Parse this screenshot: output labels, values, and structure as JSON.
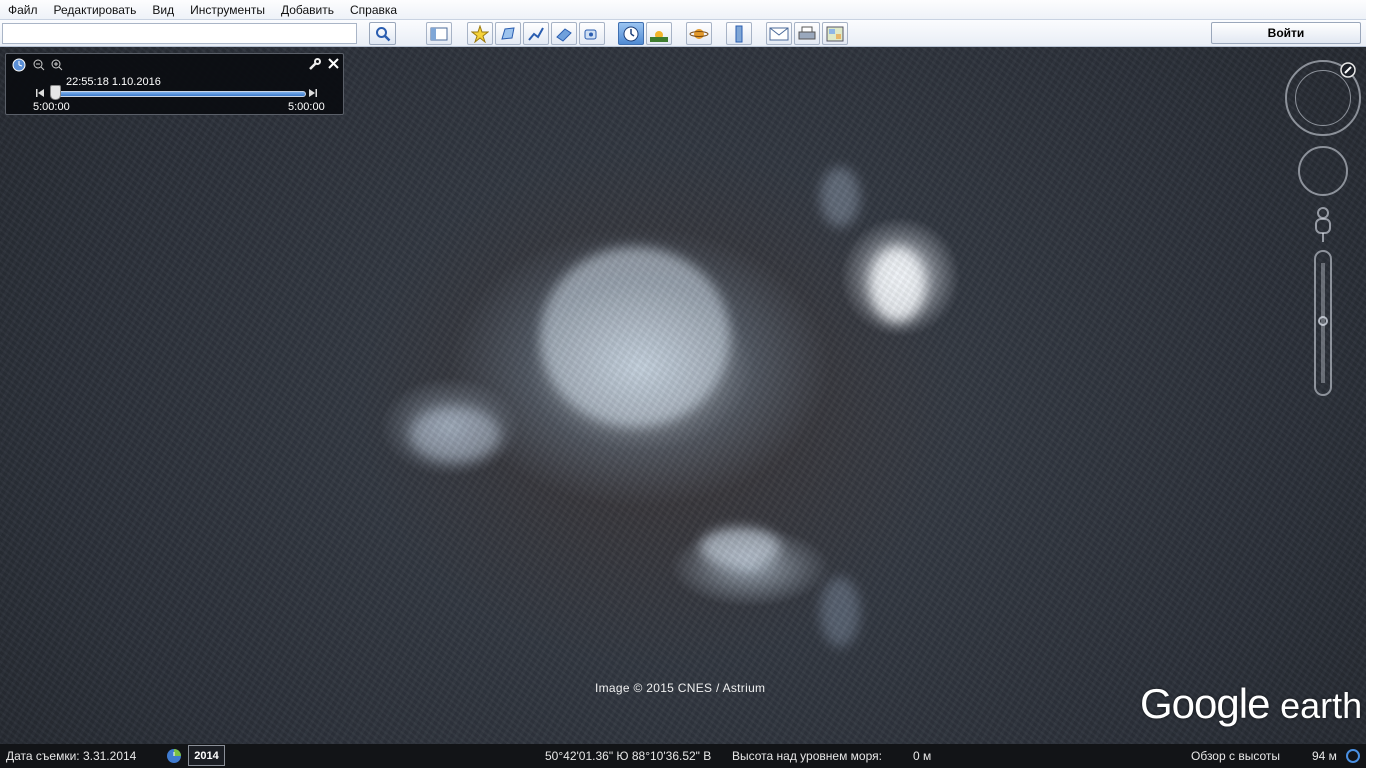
{
  "menu": {
    "items": [
      "Файл",
      "Редактировать",
      "Вид",
      "Инструменты",
      "Добавить",
      "Справка"
    ]
  },
  "toolbar": {
    "search_value": "",
    "login_label": "Войти",
    "buttons": [
      "sidebar-toggle-icon",
      "placemark-icon",
      "polygon-icon",
      "path-icon",
      "overlay-icon",
      "tour-icon",
      "historical-imagery-icon",
      "sunlight-icon",
      "planets-icon",
      "ruler-icon",
      "email-icon",
      "print-icon",
      "map-view-icon"
    ],
    "active_button": "historical-imagery-icon"
  },
  "time_slider": {
    "current": "22:55:18 1.10.2016",
    "start": "5:00:00",
    "end": "5:00:00"
  },
  "map": {
    "attribution": "Image © 2015 CNES / Astrium",
    "logo_google": "Google",
    "logo_earth": "earth"
  },
  "status": {
    "capture_date": "Дата съемки: 3.31.2014",
    "year": "2014",
    "coordinates": "50°42'01.36\" Ю   88°10'36.52\" В",
    "elevation_label": "Высота над уровнем моря:",
    "elevation_value": "0 м",
    "eye_alt_label": "Обзор с высоты",
    "eye_alt_value": "94 м"
  },
  "colors": {
    "accent": "#3b78c8",
    "statusbar_bg": "#08090e"
  }
}
